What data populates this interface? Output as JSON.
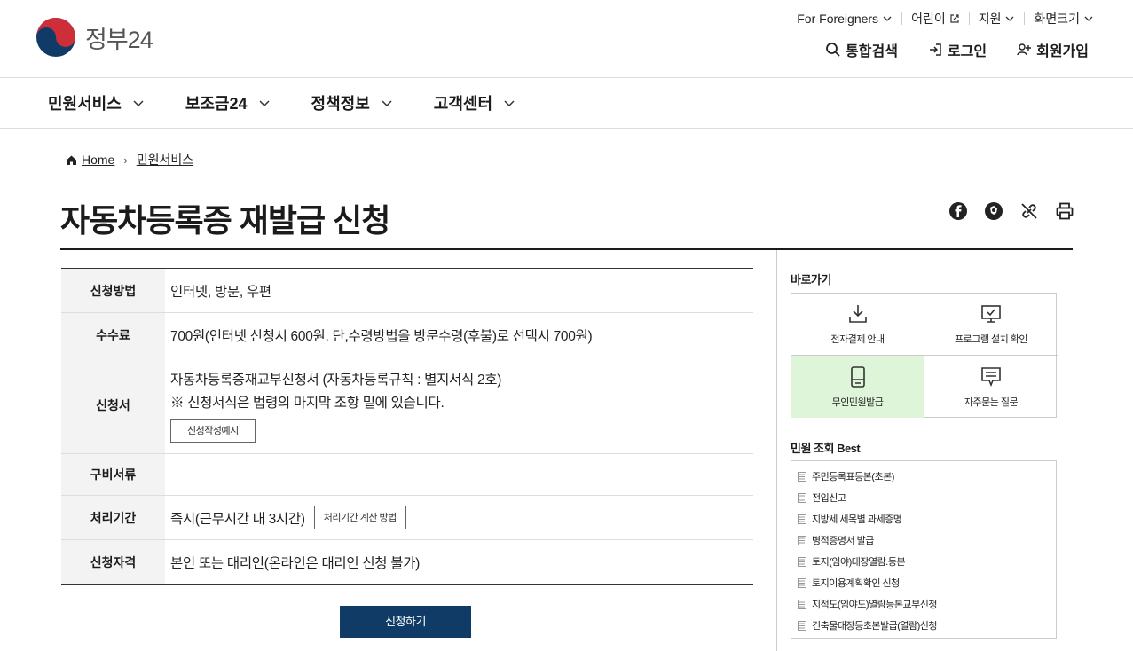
{
  "header": {
    "logo_text": "정부24",
    "util": [
      "For Foreigners",
      "어린이",
      "지원",
      "화면크기"
    ],
    "actions": [
      "통합검색",
      "로그인",
      "회원가입"
    ]
  },
  "menu": [
    "민원서비스",
    "보조금24",
    "정책정보",
    "고객센터"
  ],
  "breadcrumb": {
    "home": "Home",
    "current": "민원서비스"
  },
  "page_title": "자동차등록증 재발급 신청",
  "info": {
    "method_label": "신청방법",
    "method_value": "인터넷, 방문, 우편",
    "fee_label": "수수료",
    "fee_value": "700원(인터넷 신청시 600원. 단,수령방법을 방문수령(후불)로 선택시 700원)",
    "form_label": "신청서",
    "form_value1": "자동차등록증재교부신청서 (자동차등록규칙 : 별지서식 2호)",
    "form_value2": "※ 신청서식은 법령의 마지막 조항 밑에 있습니다.",
    "form_button": "신청작성예시",
    "docs_label": "구비서류",
    "period_label": "처리기간",
    "period_value": "즉시(근무시간 내 3시간)",
    "period_button": "처리기간 계산 방법",
    "eligibility_label": "신청자격",
    "eligibility_value": "본인 또는 대리인(온라인은 대리인 신청 불가)"
  },
  "apply_button": "신청하기",
  "sidebar": {
    "shortcut_title": "바로가기",
    "shortcuts": [
      "전자결제 안내",
      "프로그램 설치 확인",
      "무인민원발급",
      "자주묻는 질문"
    ],
    "best_title": "민원 조회 Best",
    "best": [
      "주민등록표등본(초본)",
      "전입신고",
      "지방세 세목별 과세증명",
      "병적증명서 발급",
      "토지(임야)대장열람.등본",
      "토지이용계획확인 신청",
      "지적도(임야도)열람등본교부신청",
      "건축물대장등초본발급(열람)신청"
    ]
  },
  "colors": {
    "primary": "#0f3b66",
    "highlight": "#dff5d9",
    "logo_red": "#cd2e3a",
    "logo_blue": "#0f3b66"
  }
}
